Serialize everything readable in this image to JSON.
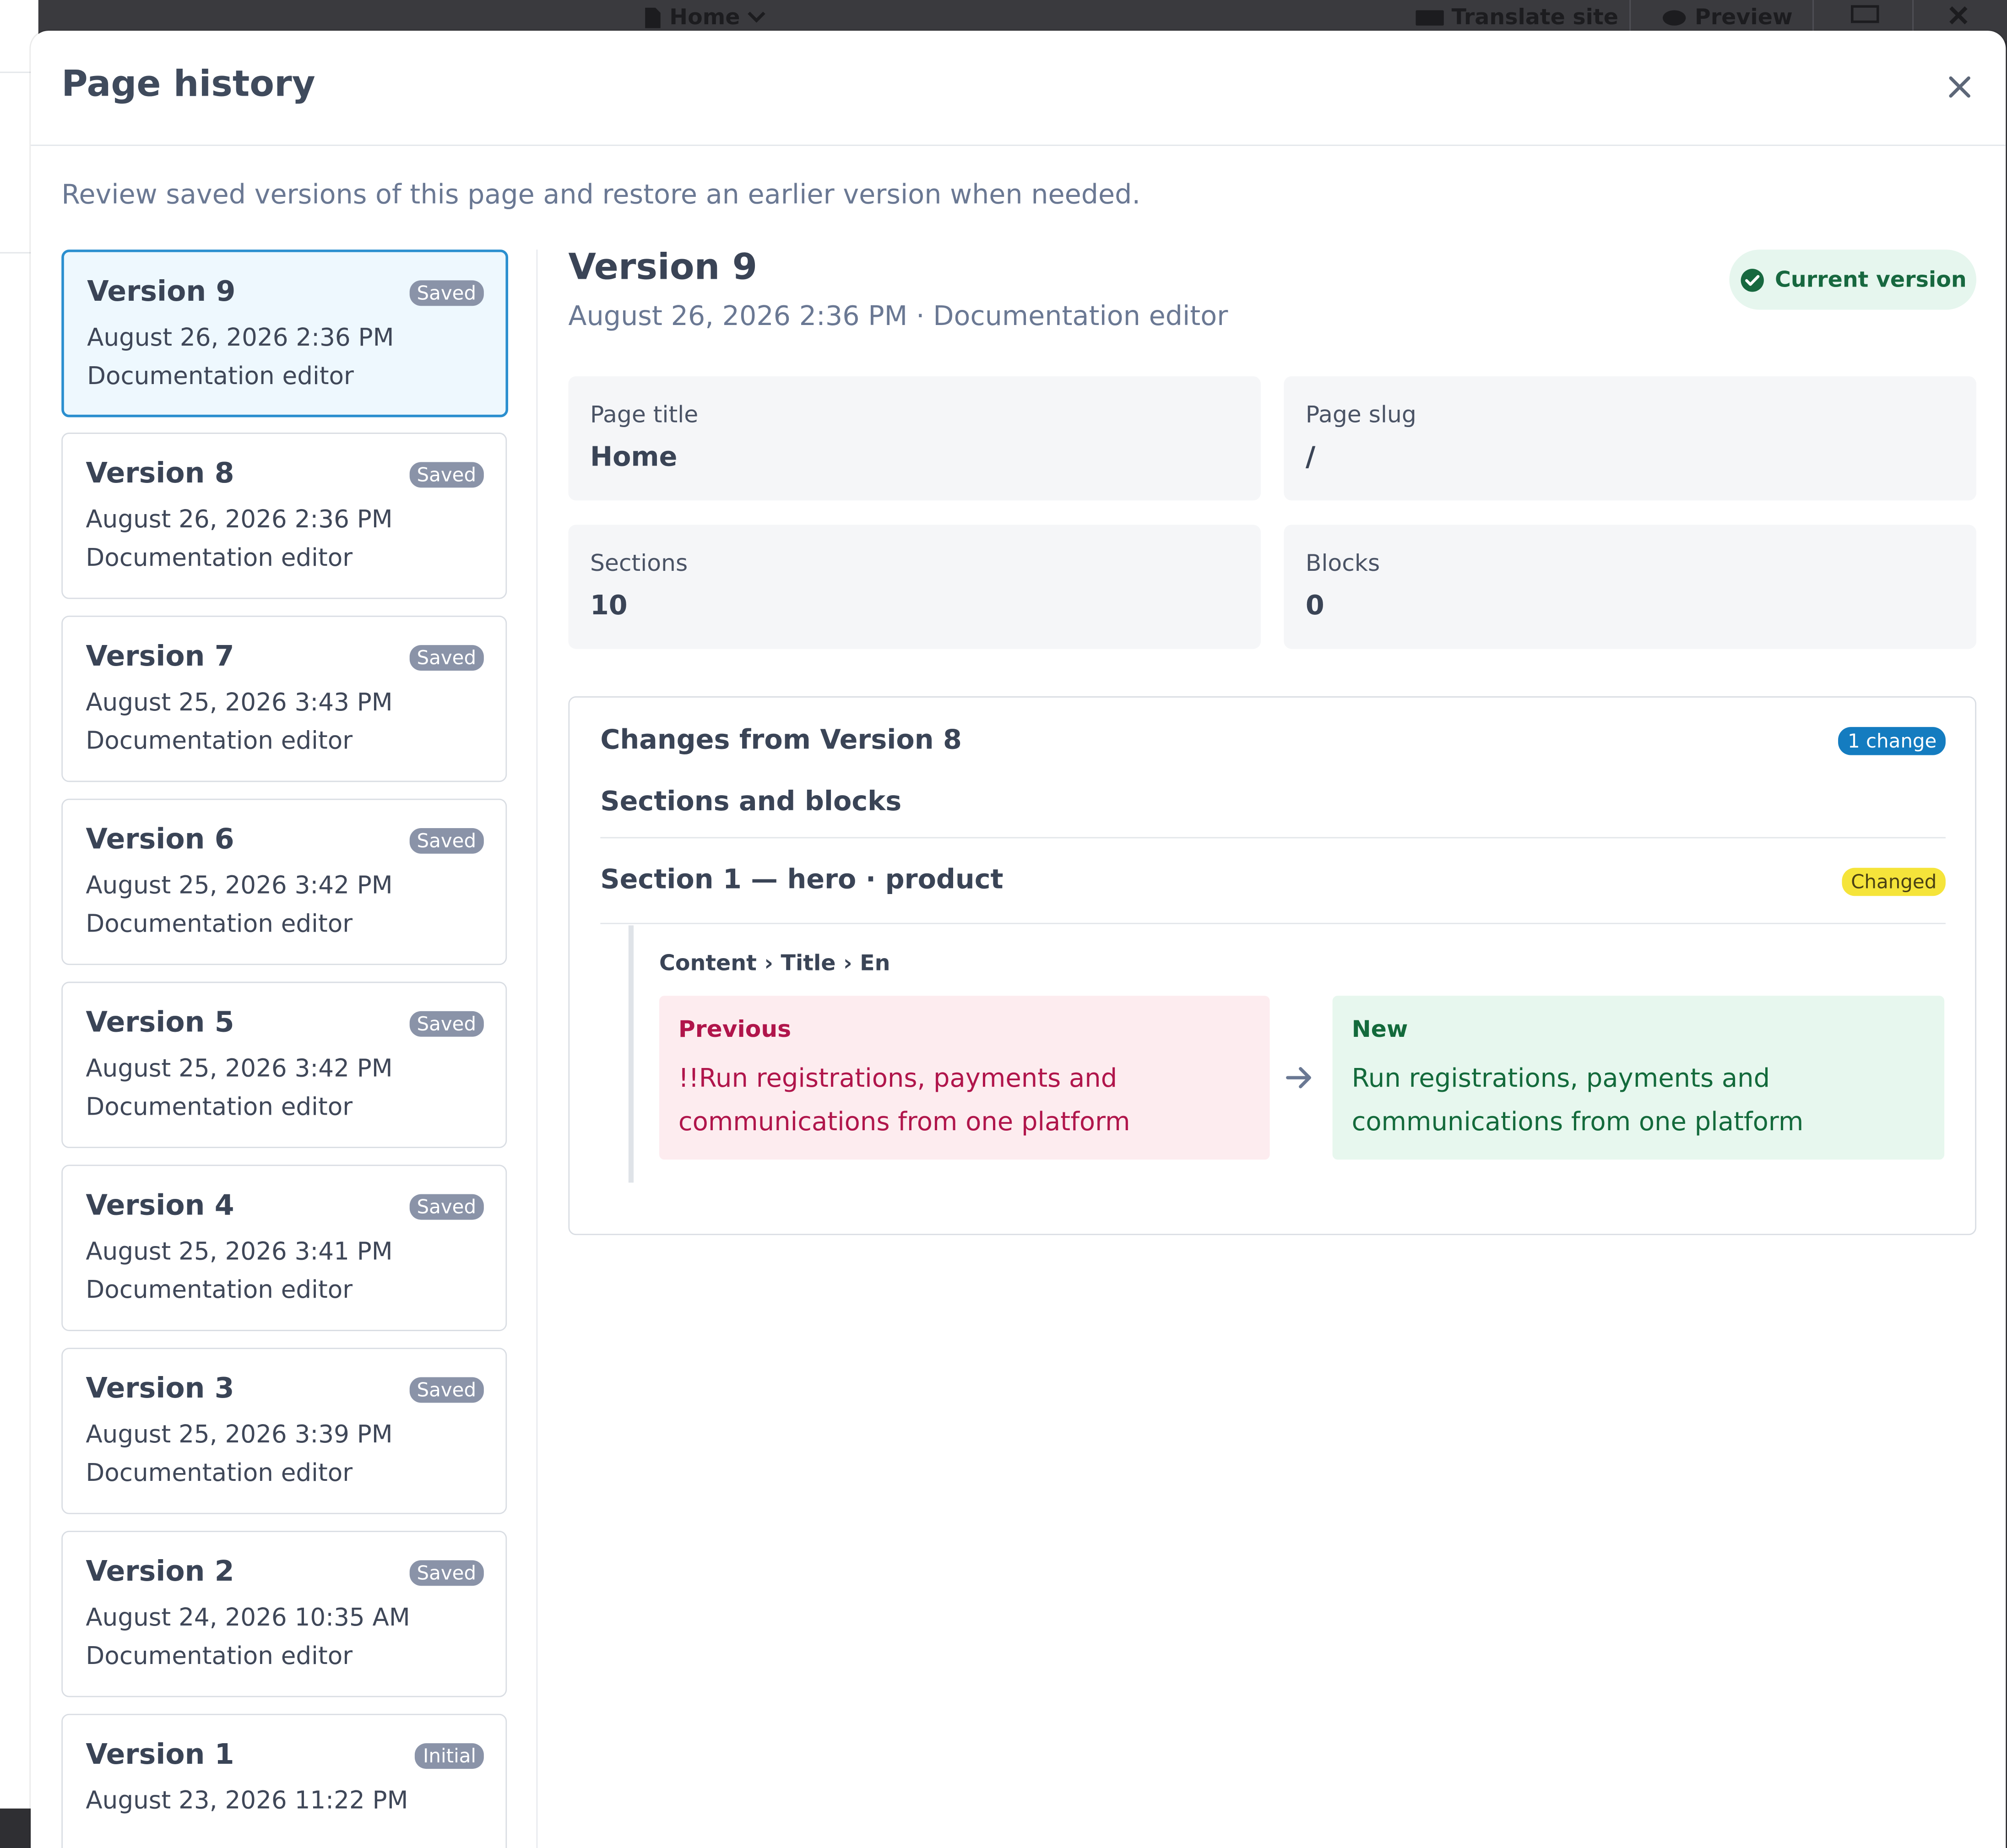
{
  "topbar": {
    "page_label": "Home",
    "translate_label": "Translate site",
    "preview_label": "Preview"
  },
  "modal": {
    "title": "Page history",
    "description": "Review saved versions of this page and restore an earlier version when needed."
  },
  "versions": [
    {
      "name": "Version 9",
      "date": "August 26, 2026 2:36 PM",
      "author": "Documentation editor",
      "badge": "Saved"
    },
    {
      "name": "Version 8",
      "date": "August 26, 2026 2:36 PM",
      "author": "Documentation editor",
      "badge": "Saved"
    },
    {
      "name": "Version 7",
      "date": "August 25, 2026 3:43 PM",
      "author": "Documentation editor",
      "badge": "Saved"
    },
    {
      "name": "Version 6",
      "date": "August 25, 2026 3:42 PM",
      "author": "Documentation editor",
      "badge": "Saved"
    },
    {
      "name": "Version 5",
      "date": "August 25, 2026 3:42 PM",
      "author": "Documentation editor",
      "badge": "Saved"
    },
    {
      "name": "Version 4",
      "date": "August 25, 2026 3:41 PM",
      "author": "Documentation editor",
      "badge": "Saved"
    },
    {
      "name": "Version 3",
      "date": "August 25, 2026 3:39 PM",
      "author": "Documentation editor",
      "badge": "Saved"
    },
    {
      "name": "Version 2",
      "date": "August 24, 2026 10:35 AM",
      "author": "Documentation editor",
      "badge": "Saved"
    },
    {
      "name": "Version 1",
      "date": "August 23, 2026 11:22 PM",
      "author": "",
      "badge": "Initial"
    }
  ],
  "detail": {
    "title": "Version 9",
    "subtitle": "August 26, 2026 2:36 PM · Documentation editor",
    "status": "Current version",
    "stats": {
      "page_title_label": "Page title",
      "page_title_value": "Home",
      "page_slug_label": "Page slug",
      "page_slug_value": "/",
      "sections_label": "Sections",
      "sections_value": "10",
      "blocks_label": "Blocks",
      "blocks_value": "0"
    },
    "changes": {
      "title": "Changes from Version 8",
      "count": "1 change",
      "group": "Sections and blocks",
      "section_title": "Section 1 — hero · product",
      "section_status": "Changed",
      "field_path": "Content › Title › En",
      "previous_label": "Previous",
      "previous_text": "!!Run registrations, payments and communications from one platform",
      "new_label": "New",
      "new_text": "Run registrations, payments and communications from one platform"
    }
  },
  "colors": {
    "accent": "#2b8fcf",
    "current_green": "#17683f",
    "changed_yellow": "#f5e43a",
    "count_blue": "#147cc0"
  }
}
